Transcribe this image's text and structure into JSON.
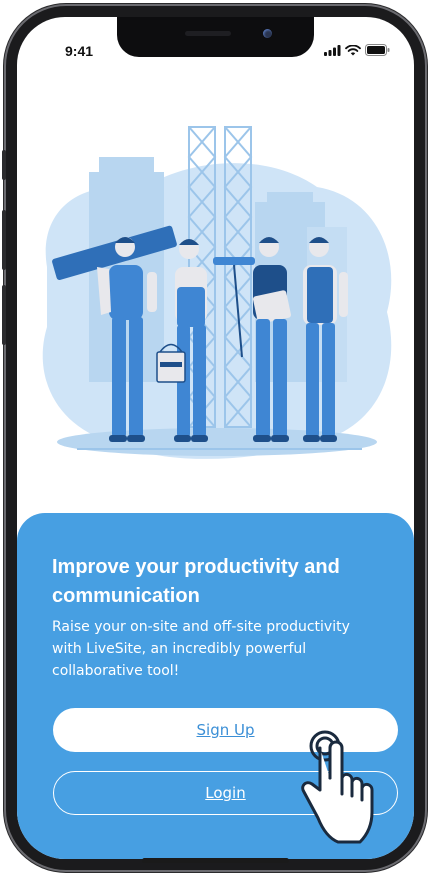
{
  "status_bar": {
    "time": "9:41"
  },
  "onboarding": {
    "headline": "Improve your productivity and communication",
    "description": "Raise your on-site and off-site productivity with LiveSite, an incredibly powerful collaborative tool!",
    "signup_label": "Sign Up",
    "login_label": "Login"
  },
  "colors": {
    "accent": "#479fe2",
    "button_text": "#3b8fd6",
    "illustration_dark": "#2f6fb8",
    "illustration_light": "#cfe4f7"
  },
  "icons": [
    "signal-icon",
    "wifi-icon",
    "battery-icon",
    "tap-hand-icon"
  ]
}
